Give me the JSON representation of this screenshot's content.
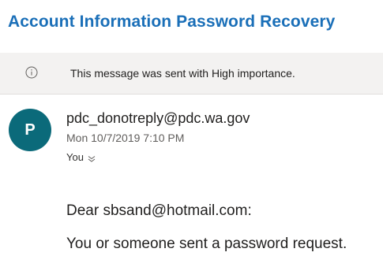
{
  "email": {
    "subject": "Account Information Password Recovery",
    "importance_banner": {
      "icon": "info-icon",
      "text": "This message was sent with High importance."
    },
    "sender": {
      "avatar_initial": "P",
      "avatar_color": "#0b6a7a",
      "address": "pdc_donotreply@pdc.wa.gov",
      "date": "Mon 10/7/2019 7:10 PM",
      "recipient": "You",
      "recipient_icon": "chevron-down-icon"
    },
    "body": {
      "greeting": "Dear sbsand@hotmail.com:",
      "line1": "You or someone sent a password request."
    }
  },
  "colors": {
    "subject": "#1a6fb8",
    "banner_bg": "#f3f2f1"
  }
}
